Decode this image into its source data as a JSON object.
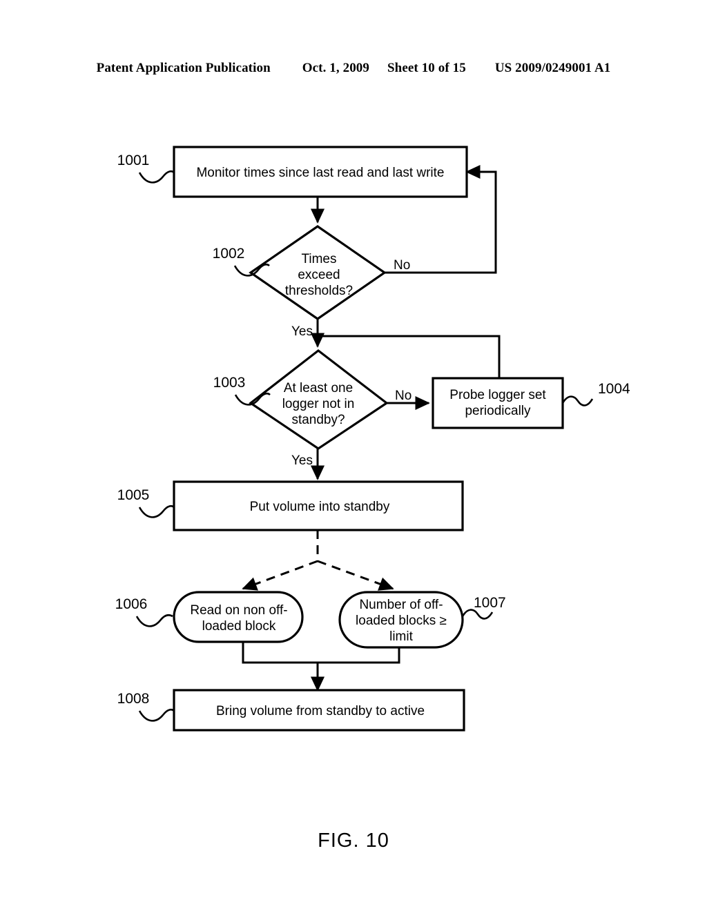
{
  "header": {
    "publication": "Patent Application Publication",
    "date": "Oct. 1, 2009",
    "sheet": "Sheet 10 of 15",
    "number": "US 2009/0249001 A1"
  },
  "figure": {
    "caption": "FIG. 10"
  },
  "diagram": {
    "type": "flowchart",
    "nodes": [
      {
        "ref": "1001",
        "shape": "process",
        "lines": [
          "Monitor times since last read and last write"
        ]
      },
      {
        "ref": "1002",
        "shape": "decision",
        "lines": [
          "Times",
          "exceed",
          "thresholds?"
        ]
      },
      {
        "ref": "1003",
        "shape": "decision",
        "lines": [
          "At least one",
          "logger not in",
          "standby?"
        ]
      },
      {
        "ref": "1004",
        "shape": "process",
        "lines": [
          "Probe logger set",
          "periodically"
        ]
      },
      {
        "ref": "1005",
        "shape": "process",
        "lines": [
          "Put volume into standby"
        ]
      },
      {
        "ref": "1006",
        "shape": "rounded",
        "lines": [
          "Read on non off-",
          "loaded block"
        ]
      },
      {
        "ref": "1007",
        "shape": "rounded",
        "lines": [
          "Number of off-",
          "loaded blocks ≥",
          "limit"
        ]
      },
      {
        "ref": "1008",
        "shape": "process",
        "lines": [
          "Bring volume from standby to active"
        ]
      }
    ],
    "edge_labels": {
      "d1002_no": "No",
      "d1002_yes": "Yes",
      "d1003_no": "No",
      "d1003_yes": "Yes"
    }
  }
}
